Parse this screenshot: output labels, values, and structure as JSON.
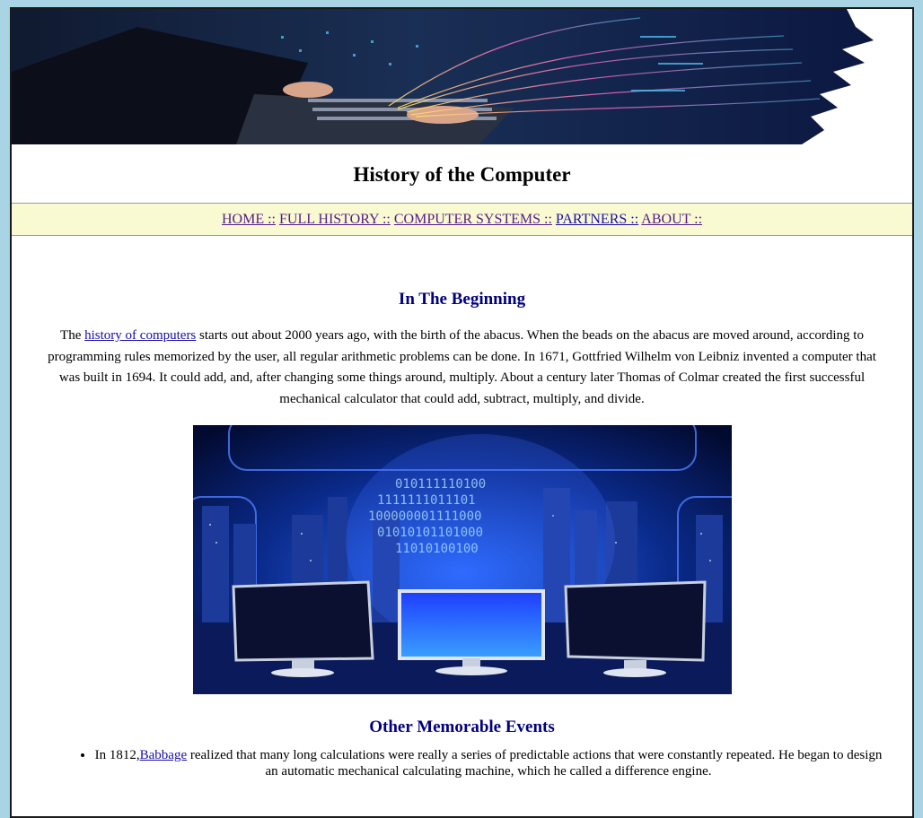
{
  "site": {
    "title": "History of the Computer"
  },
  "nav": {
    "items": [
      {
        "label": "HOME ::",
        "visited": true
      },
      {
        "label": "FULL HISTORY ::",
        "visited": true
      },
      {
        "label": "COMPUTER SYSTEMS ::",
        "visited": true
      },
      {
        "label": "PARTNERS ::",
        "visited": false
      },
      {
        "label": "ABOUT ::",
        "visited": true
      }
    ]
  },
  "beginning": {
    "heading": "In The Beginning",
    "text_before_link": "The ",
    "link_text": "history of computers",
    "text_after_link": " starts out about 2000 years ago, with the birth of the abacus. When the beads on the abacus are moved around, according to programming rules memorized by the user, all regular arithmetic problems can be done. In 1671, Gottfried Wilhelm von Leibniz invented a computer that was built in 1694. It could add, and, after changing some things around, multiply. About a century later Thomas of Colmar created the first successful mechanical calculator that could add, subtract, multiply, and divide."
  },
  "events": {
    "heading": "Other Memorable Events",
    "items": [
      {
        "prefix": "In 1812,",
        "link_text": "Babbage",
        "text": " realized that many long calculations were really a series of predictable actions that were constantly repeated. He began to design an automatic mechanical calculating machine, which he called a difference engine."
      }
    ]
  },
  "images": {
    "hero_digits": [
      "010111110100",
      "1111111011101",
      "100000001111000",
      "01010101101000",
      "11010100100"
    ]
  },
  "colors": {
    "page_bg": "#a9d4e4",
    "nav_bg": "#fafad2",
    "heading": "#000080",
    "link": "#1a0dab",
    "visited_link": "#551a8b"
  }
}
